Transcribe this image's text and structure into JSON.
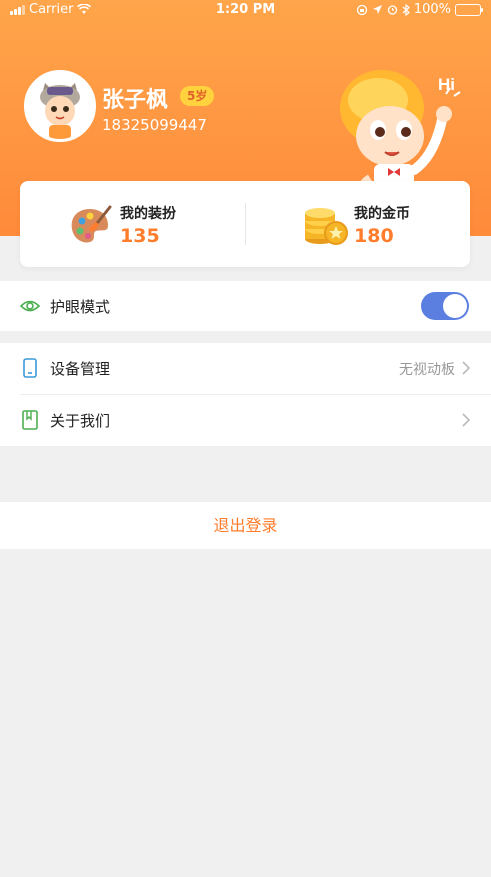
{
  "status_bar": {
    "carrier": "Carrier",
    "time": "1:20 PM",
    "battery": "100%"
  },
  "profile": {
    "name": "张子枫",
    "age_badge": "5岁",
    "phone": "18325099447"
  },
  "mascot": {
    "greeting": "Hi"
  },
  "stats": {
    "outfit": {
      "label": "我的装扮",
      "value": "135"
    },
    "coins": {
      "label": "我的金币",
      "value": "180"
    }
  },
  "settings": {
    "eye_mode": {
      "label": "护眼模式",
      "enabled": true
    },
    "device": {
      "label": "设备管理",
      "value": "无视动板"
    },
    "about": {
      "label": "关于我们"
    }
  },
  "logout_label": "退出登录",
  "colors": {
    "accent": "#ff7d2d",
    "header_top": "#ffa54a",
    "header_bottom": "#ff8a3a",
    "toggle_on": "#5b7fe0"
  }
}
